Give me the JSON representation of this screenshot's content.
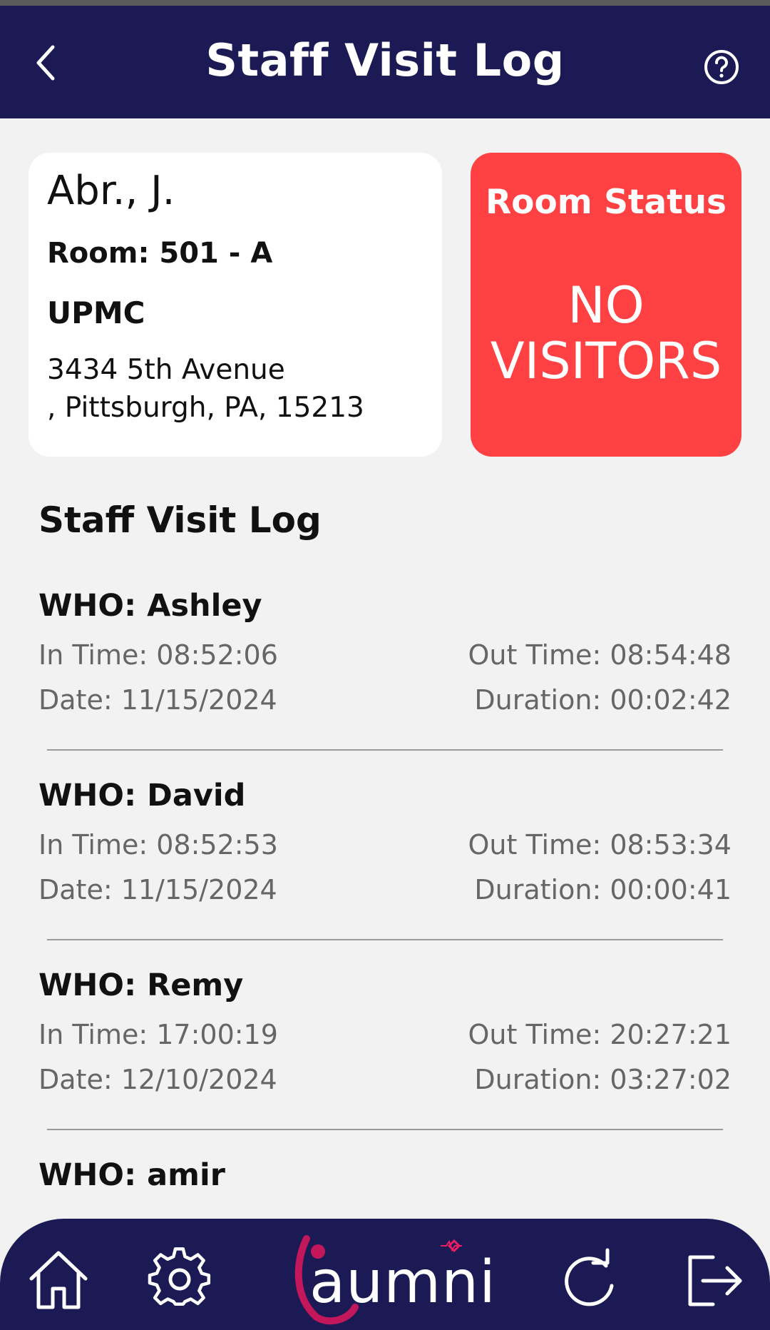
{
  "header": {
    "title": "Staff Visit Log"
  },
  "patient": {
    "name": "Abr., J.",
    "room": "Room: 501 - A",
    "facility": "UPMC",
    "address_line1": "3434 5th Avenue",
    "address_line2": ", Pittsburgh, PA, 15213"
  },
  "room_status": {
    "label": "Room Status",
    "value_line1": "NO",
    "value_line2": "VISITORS",
    "color": "#ff4144"
  },
  "section_title": "Staff Visit Log",
  "visits": [
    {
      "who": "WHO: Ashley",
      "in_time": "In Time: 08:52:06",
      "out_time": "Out Time: 08:54:48",
      "date": "Date: 11/15/2024",
      "duration": "Duration: 00:02:42"
    },
    {
      "who": "WHO: David",
      "in_time": "In Time: 08:52:53",
      "out_time": "Out Time: 08:53:34",
      "date": "Date: 11/15/2024",
      "duration": "Duration: 00:00:41"
    },
    {
      "who": "WHO: Remy",
      "in_time": "In Time: 17:00:19",
      "out_time": "Out Time: 20:27:21",
      "date": "Date: 12/10/2024",
      "duration": "Duration: 03:27:02"
    },
    {
      "who": "WHO: amir"
    }
  ],
  "nav": {
    "logo_text": "aumni",
    "icons": [
      "home-icon",
      "gear-icon",
      "refresh-icon",
      "logout-icon"
    ]
  },
  "colors": {
    "header_bg": "#1b1a55",
    "page_bg": "#f2f2f2",
    "status_red": "#ff4144",
    "logo_accent": "#c2185b"
  }
}
